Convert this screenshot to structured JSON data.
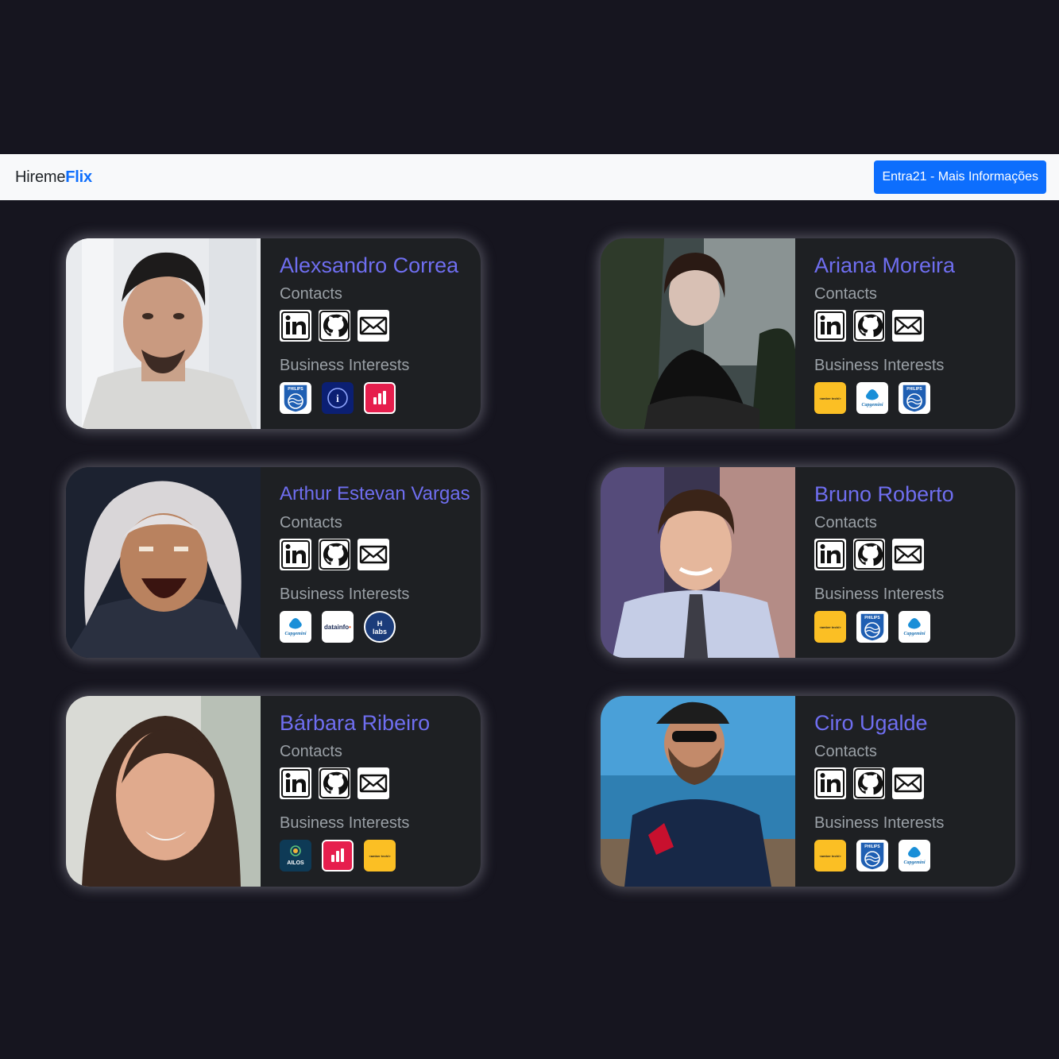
{
  "navbar": {
    "brand_part1": "Hireme",
    "brand_part2": "Flix",
    "button_label": "Entra21 - Mais Informações"
  },
  "labels": {
    "contacts": "Contacts",
    "business_interests": "Business Interests"
  },
  "cards": [
    {
      "name": "Alexsandro Correa",
      "contacts": [
        "linkedin-icon",
        "github-icon",
        "email-icon"
      ],
      "interests": [
        {
          "kind": "philips",
          "text": "PHILIPS"
        },
        {
          "kind": "dark-blue",
          "text": "i"
        },
        {
          "kind": "red",
          "text": ""
        }
      ]
    },
    {
      "name": "Ariana Moreira",
      "contacts": [
        "linkedin-icon",
        "github-icon",
        "email-icon"
      ],
      "interests": [
        {
          "kind": "amber",
          "text": "<amber tech/>"
        },
        {
          "kind": "cap",
          "text": "Capgemini"
        },
        {
          "kind": "philips",
          "text": "PHILIPS"
        }
      ]
    },
    {
      "name": "Arthur Estevan Vargas",
      "contacts": [
        "linkedin-icon",
        "github-icon",
        "email-icon"
      ],
      "interests": [
        {
          "kind": "cap",
          "text": "Capgemini"
        },
        {
          "kind": "datainfo",
          "text": "datainfo"
        },
        {
          "kind": "hlabs",
          "text": "H labs"
        }
      ]
    },
    {
      "name": "Bruno Roberto",
      "contacts": [
        "linkedin-icon",
        "github-icon",
        "email-icon"
      ],
      "interests": [
        {
          "kind": "amber",
          "text": "<amber tech/>"
        },
        {
          "kind": "philips",
          "text": "PHILIPS"
        },
        {
          "kind": "cap",
          "text": "Capgemini"
        }
      ]
    },
    {
      "name": "Bárbara Ribeiro",
      "contacts": [
        "linkedin-icon",
        "github-icon",
        "email-icon"
      ],
      "interests": [
        {
          "kind": "ailos",
          "text": "AILOS"
        },
        {
          "kind": "red",
          "text": ""
        },
        {
          "kind": "amber",
          "text": "<amber tech/>"
        }
      ]
    },
    {
      "name": "Ciro Ugalde",
      "contacts": [
        "linkedin-icon",
        "github-icon",
        "email-icon"
      ],
      "interests": [
        {
          "kind": "amber",
          "text": "<amber tech/>"
        },
        {
          "kind": "philips",
          "text": "PHILIPS"
        },
        {
          "kind": "cap",
          "text": "Capgemini"
        }
      ]
    }
  ]
}
